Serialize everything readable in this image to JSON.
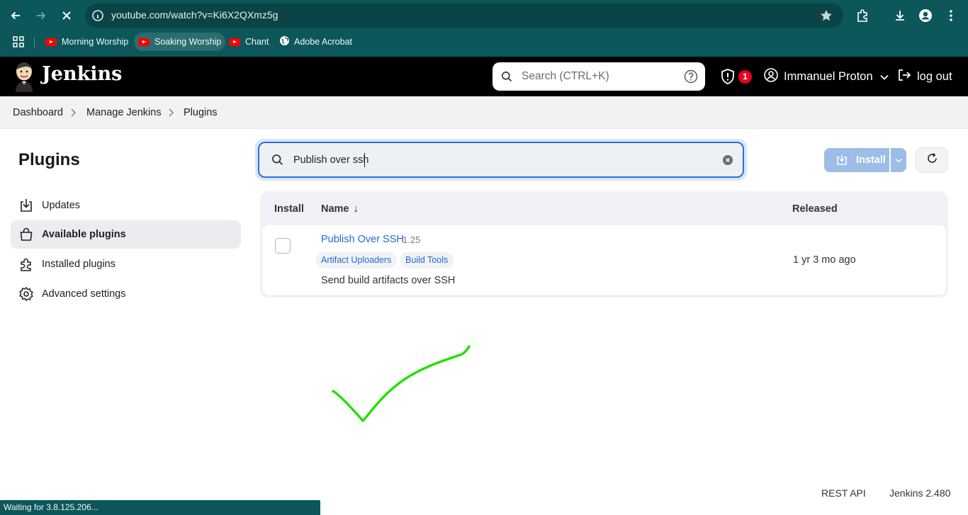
{
  "browser": {
    "url": "youtube.com/watch?v=Ki6X2QXmz5g",
    "bookmarks": [
      {
        "label": "Morning Worship",
        "icon": "youtube-icon"
      },
      {
        "label": "Soaking Worship",
        "icon": "youtube-icon"
      },
      {
        "label": "Chant",
        "icon": "youtube-icon"
      },
      {
        "label": "Adobe Acrobat",
        "icon": "globe-icon"
      }
    ],
    "status_text": "Waiting for 3.8.125.206..."
  },
  "header": {
    "brand": "Jenkins",
    "search_placeholder": "Search (CTRL+K)",
    "security_count": "1",
    "user_name": "Immanuel Proton",
    "logout_label": "log out"
  },
  "breadcrumb": [
    "Dashboard",
    "Manage Jenkins",
    "Plugins"
  ],
  "sidebar": {
    "title": "Plugins",
    "items": [
      {
        "label": "Updates",
        "icon": "download-icon",
        "active": false
      },
      {
        "label": "Available plugins",
        "icon": "shopping-bag-icon",
        "active": true
      },
      {
        "label": "Installed plugins",
        "icon": "puzzle-icon",
        "active": false
      },
      {
        "label": "Advanced settings",
        "icon": "gear-icon",
        "active": false
      }
    ]
  },
  "plugin_search": {
    "value": "Publish over ssh"
  },
  "actions": {
    "install_label": "Install"
  },
  "table": {
    "headers": {
      "install": "Install",
      "name": "Name",
      "name_sort": "↓",
      "released": "Released"
    },
    "rows": [
      {
        "name": "Publish Over SSH",
        "version": "1.25",
        "tags": [
          "Artifact Uploaders",
          "Build Tools"
        ],
        "description": "Send build artifacts over SSH",
        "released": "1 yr 3 mo ago",
        "checked": false
      }
    ]
  },
  "footer": {
    "rest_api": "REST API",
    "version": "Jenkins 2.480"
  },
  "colors": {
    "chrome": "#0b5759",
    "link": "#2767d5",
    "install_button": "#9dbce6",
    "checkmark": "#22e000"
  }
}
